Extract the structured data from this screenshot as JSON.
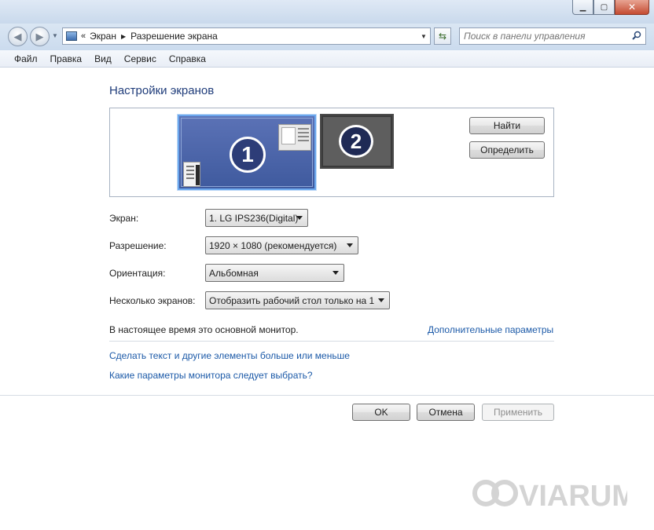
{
  "window": {
    "minimize_icon": "minimize-icon",
    "maximize_icon": "maximize-icon",
    "close_icon": "close-icon"
  },
  "navigation": {
    "breadcrumb_overflow": "«",
    "breadcrumb": [
      "Экран",
      "Разрешение экрана"
    ],
    "search_placeholder": "Поиск в панели управления"
  },
  "menu": [
    {
      "label": "Файл"
    },
    {
      "label": "Правка"
    },
    {
      "label": "Вид"
    },
    {
      "label": "Сервис"
    },
    {
      "label": "Справка"
    }
  ],
  "page": {
    "title": "Настройки экранов",
    "monitors": [
      "1",
      "2"
    ],
    "find_button": "Найти",
    "identify_button": "Определить",
    "form": {
      "display_label": "Экран:",
      "display_value": "1. LG IPS236(Digital)",
      "resolution_label": "Разрешение:",
      "resolution_value": "1920 × 1080 (рекомендуется)",
      "orientation_label": "Ориентация:",
      "orientation_value": "Альбомная",
      "multiple_label": "Несколько экранов:",
      "multiple_value": "Отобразить рабочий стол только на 1"
    },
    "main_monitor_text": "В настоящее время это основной монитор.",
    "advanced_link": "Дополнительные параметры",
    "text_size_link": "Сделать текст и другие элементы больше или меньше",
    "which_settings_link": "Какие параметры монитора следует выбрать?"
  },
  "footer": {
    "ok": "OK",
    "cancel": "Отмена",
    "apply": "Применить"
  },
  "watermark": "VIARUM",
  "colors": {
    "link": "#1c5aa8",
    "title": "#1f3c7a",
    "selected_monitor": "#4a63a8"
  }
}
